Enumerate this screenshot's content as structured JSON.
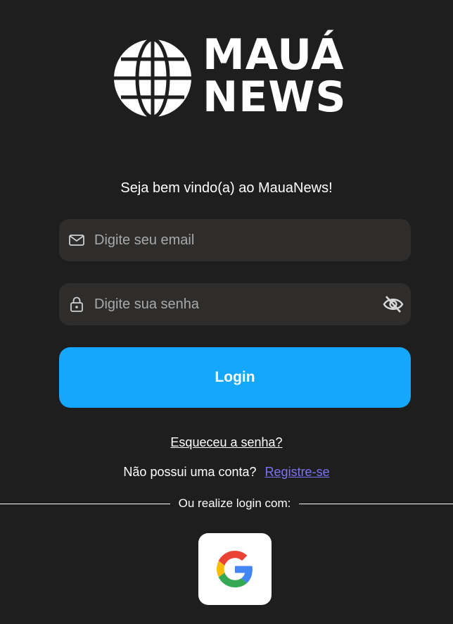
{
  "logo": {
    "line1": "MAUÁ",
    "line2": "NEWS",
    "icon": "globe-icon"
  },
  "welcome_text": "Seja bem vindo(a) ao MauaNews!",
  "email": {
    "placeholder": "Digite seu email",
    "value": "",
    "icon": "mail-icon"
  },
  "password": {
    "placeholder": "Digite sua senha",
    "value": "",
    "icon": "lock-icon",
    "toggle_icon": "eye-off-icon"
  },
  "login_label": "Login",
  "forgot_label": "Esqueceu a senha?",
  "register": {
    "question": "Não possui uma conta?",
    "link": "Registre-se"
  },
  "divider_text": "Ou realize login com:",
  "social": {
    "google_icon": "google-icon"
  },
  "colors": {
    "background": "#1e1e1e",
    "field": "#2e2d2c",
    "primary": "#14a7fc",
    "link": "#7a73f5"
  }
}
